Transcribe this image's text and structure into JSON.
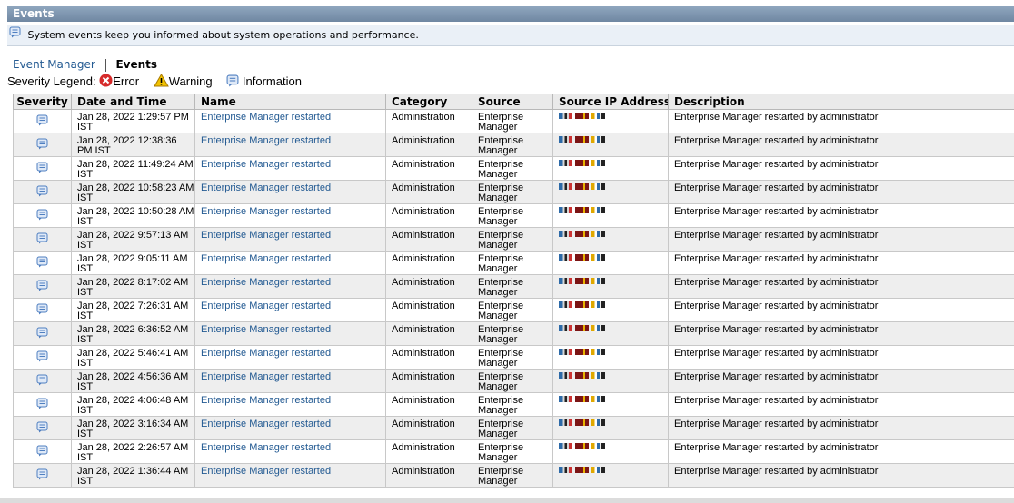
{
  "window": {
    "title": "Events"
  },
  "info_bar": {
    "message": "System events keep you informed about system operations and performance.",
    "icon": "info-message-icon"
  },
  "breadcrumb": {
    "parent": "Event Manager",
    "current": "Events"
  },
  "legend": {
    "label": "Severity Legend:",
    "items": [
      {
        "label": "Error",
        "icon": "error-icon",
        "color": "#d62b2b"
      },
      {
        "label": "Warning",
        "icon": "warning-icon",
        "color": "#f2c200"
      },
      {
        "label": "Information",
        "icon": "information-icon",
        "color": "#4f7fc0"
      }
    ]
  },
  "table": {
    "columns": [
      "Severity",
      "Date and Time",
      "Name",
      "Category",
      "Source",
      "Source IP Address",
      "Description"
    ],
    "rows": [
      {
        "severity": "information",
        "datetime": "Jan 28, 2022 1:29:57 PM IST",
        "name": "Enterprise Manager restarted",
        "category": "Administration",
        "source": "Enterprise Manager",
        "description": "Enterprise Manager restarted by administrator"
      },
      {
        "severity": "information",
        "datetime": "Jan 28, 2022 12:38:36 PM IST",
        "name": "Enterprise Manager restarted",
        "category": "Administration",
        "source": "Enterprise Manager",
        "description": "Enterprise Manager restarted by administrator"
      },
      {
        "severity": "information",
        "datetime": "Jan 28, 2022 11:49:24 AM IST",
        "name": "Enterprise Manager restarted",
        "category": "Administration",
        "source": "Enterprise Manager",
        "description": "Enterprise Manager restarted by administrator"
      },
      {
        "severity": "information",
        "datetime": "Jan 28, 2022 10:58:23 AM IST",
        "name": "Enterprise Manager restarted",
        "category": "Administration",
        "source": "Enterprise Manager",
        "description": "Enterprise Manager restarted by administrator"
      },
      {
        "severity": "information",
        "datetime": "Jan 28, 2022 10:50:28 AM IST",
        "name": "Enterprise Manager restarted",
        "category": "Administration",
        "source": "Enterprise Manager",
        "description": "Enterprise Manager restarted by administrator"
      },
      {
        "severity": "information",
        "datetime": "Jan 28, 2022 9:57:13 AM IST",
        "name": "Enterprise Manager restarted",
        "category": "Administration",
        "source": "Enterprise Manager",
        "description": "Enterprise Manager restarted by administrator"
      },
      {
        "severity": "information",
        "datetime": "Jan 28, 2022 9:05:11 AM IST",
        "name": "Enterprise Manager restarted",
        "category": "Administration",
        "source": "Enterprise Manager",
        "description": "Enterprise Manager restarted by administrator"
      },
      {
        "severity": "information",
        "datetime": "Jan 28, 2022 8:17:02 AM IST",
        "name": "Enterprise Manager restarted",
        "category": "Administration",
        "source": "Enterprise Manager",
        "description": "Enterprise Manager restarted by administrator"
      },
      {
        "severity": "information",
        "datetime": "Jan 28, 2022 7:26:31 AM IST",
        "name": "Enterprise Manager restarted",
        "category": "Administration",
        "source": "Enterprise Manager",
        "description": "Enterprise Manager restarted by administrator"
      },
      {
        "severity": "information",
        "datetime": "Jan 28, 2022 6:36:52 AM IST",
        "name": "Enterprise Manager restarted",
        "category": "Administration",
        "source": "Enterprise Manager",
        "description": "Enterprise Manager restarted by administrator"
      },
      {
        "severity": "information",
        "datetime": "Jan 28, 2022 5:46:41 AM IST",
        "name": "Enterprise Manager restarted",
        "category": "Administration",
        "source": "Enterprise Manager",
        "description": "Enterprise Manager restarted by administrator"
      },
      {
        "severity": "information",
        "datetime": "Jan 28, 2022 4:56:36 AM IST",
        "name": "Enterprise Manager restarted",
        "category": "Administration",
        "source": "Enterprise Manager",
        "description": "Enterprise Manager restarted by administrator"
      },
      {
        "severity": "information",
        "datetime": "Jan 28, 2022 4:06:48 AM IST",
        "name": "Enterprise Manager restarted",
        "category": "Administration",
        "source": "Enterprise Manager",
        "description": "Enterprise Manager restarted by administrator"
      },
      {
        "severity": "information",
        "datetime": "Jan 28, 2022 3:16:34 AM IST",
        "name": "Enterprise Manager restarted",
        "category": "Administration",
        "source": "Enterprise Manager",
        "description": "Enterprise Manager restarted by administrator"
      },
      {
        "severity": "information",
        "datetime": "Jan 28, 2022 2:26:57 AM IST",
        "name": "Enterprise Manager restarted",
        "category": "Administration",
        "source": "Enterprise Manager",
        "description": "Enterprise Manager restarted by administrator"
      },
      {
        "severity": "information",
        "datetime": "Jan 28, 2022 1:36:44 AM IST",
        "name": "Enterprise Manager restarted",
        "category": "Administration",
        "source": "Enterprise Manager",
        "description": "Enterprise Manager restarted by administrator"
      }
    ]
  },
  "colors": {
    "title_bar": "#7a91ab",
    "link": "#235a92",
    "row_alt": "#eeeeee",
    "header_bg": "#eaeaea"
  }
}
